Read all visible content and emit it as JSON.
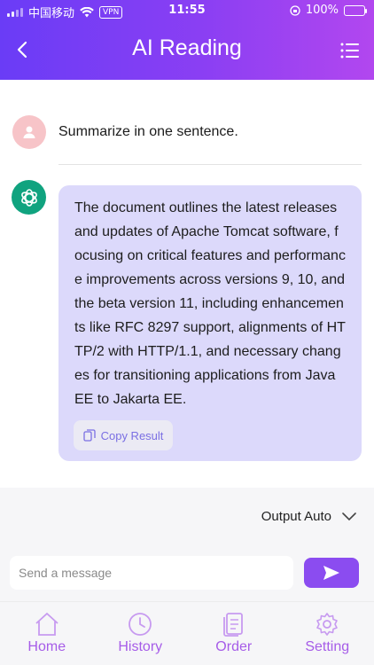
{
  "status_bar": {
    "carrier": "中国移动",
    "vpn": "VPN",
    "time": "11:55",
    "battery": "100%"
  },
  "header": {
    "title": "AI Reading"
  },
  "chat": {
    "user_message": "Summarize in one sentence.",
    "bot_message": "The document outlines the latest releases and updates of Apache Tomcat software, focusing on critical features and performance improvements across versions 9, 10, and the beta version 11, including enhancements like RFC 8297 support, alignments of HTTP/2 with HTTP/1.1, and necessary changes for transitioning applications from Java EE to Jakarta EE.",
    "copy_label": "Copy Result"
  },
  "output": {
    "label": "Output Auto"
  },
  "input": {
    "placeholder": "Send a message"
  },
  "tabs": [
    {
      "label": "Home",
      "icon": "home-icon"
    },
    {
      "label": "History",
      "icon": "clock-icon"
    },
    {
      "label": "Order",
      "icon": "document-icon"
    },
    {
      "label": "Setting",
      "icon": "gear-icon"
    }
  ],
  "colors": {
    "header_start": "#6a3cf6",
    "header_end": "#b247ef",
    "bubble": "#dcd9fb",
    "accent": "#8b4cf0",
    "bot_avatar": "#10a37f",
    "user_avatar": "#f7c4c8"
  }
}
